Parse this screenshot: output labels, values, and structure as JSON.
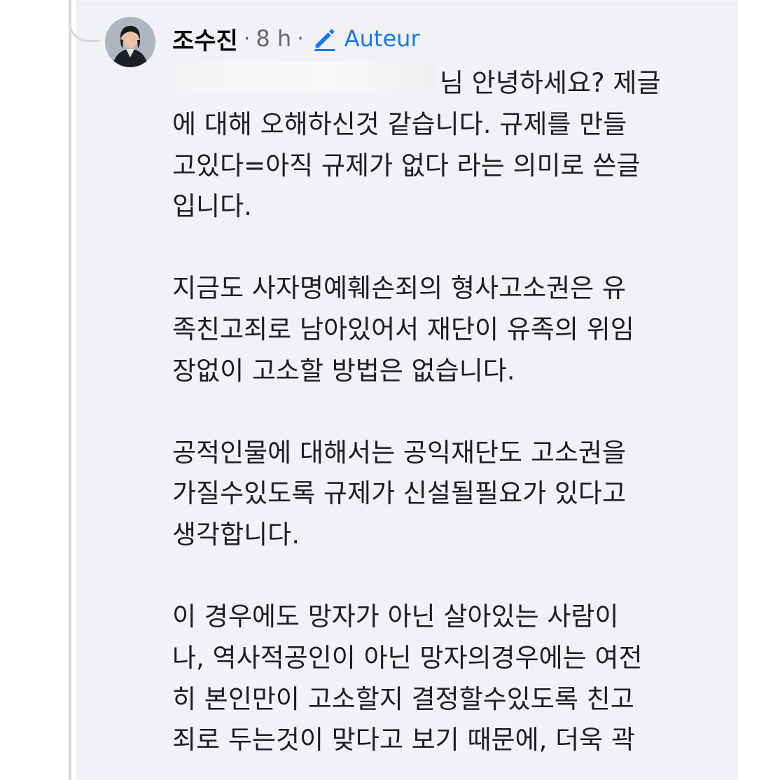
{
  "comment": {
    "author_name": "조수진",
    "separator": "·",
    "timestamp": "8 h",
    "author_badge_label": "Auteur",
    "author_badge_icon": "pencil-icon",
    "accent_color": "#1877f2",
    "paragraphs": [
      {
        "lines": [
          "님 안녕하세요? 제글",
          "에 대해 오해하신것 같습니다. 규제를 만들",
          "고있다=아직 규제가 없다 라는 의미로 쓴글",
          "입니다."
        ]
      },
      {
        "lines": [
          "지금도 사자명예훼손죄의 형사고소권은 유",
          "족친고죄로 남아있어서 재단이 유족의 위임",
          "장없이 고소할 방법은 없습니다."
        ]
      },
      {
        "lines": [
          "공적인물에 대해서는 공익재단도 고소권을",
          "가질수있도록 규제가 신설될필요가 있다고",
          "생각합니다."
        ]
      },
      {
        "lines": [
          "이 경우에도 망자가 아닌 살아있는 사람이",
          "나, 역사적공인이 아닌 망자의경우에는 여전",
          "히 본인만이 고소할지 결정할수있도록 친고",
          "죄로 두는것이 맞다고 보기 때문에,  더욱 곽"
        ]
      }
    ]
  }
}
